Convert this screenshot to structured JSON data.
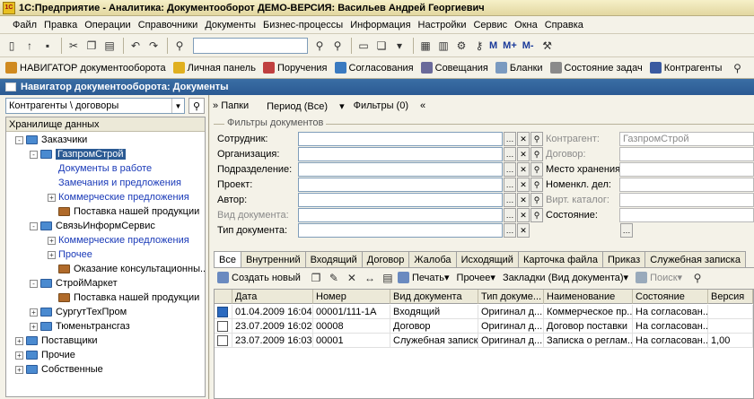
{
  "window": {
    "title": "1С:Предприятие - Аналитика: Документооборот ДЕМО-ВЕРСИЯ: Васильев Андрей Георгиевич",
    "app_icon": "1С"
  },
  "menu": [
    "Файл",
    "Правка",
    "Операции",
    "Справочники",
    "Документы",
    "Бизнес-процессы",
    "Информация",
    "Настройки",
    "Сервис",
    "Окна",
    "Справка"
  ],
  "toolbar": {
    "m1": "M",
    "m2": "M+",
    "m3": "M-"
  },
  "navbar": [
    {
      "label": "НАВИГАТОР документооборота",
      "icon": "navigator-icon",
      "color": "#d08a20"
    },
    {
      "label": "Личная панель",
      "icon": "panel-icon",
      "color": "#e0b020"
    },
    {
      "label": "Поручения",
      "icon": "tasks-icon",
      "color": "#c04040"
    },
    {
      "label": "Согласования",
      "icon": "approval-icon",
      "color": "#3a7ac0"
    },
    {
      "label": "Совещания",
      "icon": "meeting-icon",
      "color": "#6a6a9a"
    },
    {
      "label": "Бланки",
      "icon": "forms-icon",
      "color": "#7a9ac0"
    },
    {
      "label": "Состояние задач",
      "icon": "status-icon",
      "color": "#8a8a8a"
    },
    {
      "label": "Контрагенты",
      "icon": "contractors-icon",
      "color": "#3a5aa0"
    }
  ],
  "doc_title": "Навигатор документооборота: Документы",
  "left": {
    "selector": "Контрагенты \\ договоры",
    "tree_header": "Хранилище данных",
    "tree": [
      {
        "label": "Заказчики",
        "kind": "folder",
        "exp": "-"
      },
      {
        "label": "ГазпромСтрой",
        "kind": "folder",
        "exp": "-",
        "selected": true
      },
      {
        "label": "Документы в работе",
        "kind": "link"
      },
      {
        "label": "Замечания и предложения",
        "kind": "link"
      },
      {
        "label": "Коммерческие предложения",
        "kind": "link",
        "exp": "+"
      },
      {
        "label": "Поставка нашей продукции",
        "kind": "case"
      },
      {
        "label": "СвязьИнформСервис",
        "kind": "folder",
        "exp": "-"
      },
      {
        "label": "Коммерческие предложения",
        "kind": "link",
        "exp": "+"
      },
      {
        "label": "Прочее",
        "kind": "link",
        "exp": "+"
      },
      {
        "label": "Оказание консультационны...",
        "kind": "case"
      },
      {
        "label": "СтройМаркет",
        "kind": "folder",
        "exp": "-"
      },
      {
        "label": "Поставка нашей продукции",
        "kind": "case"
      },
      {
        "label": "СургутТехПром",
        "kind": "folder",
        "exp": "+"
      },
      {
        "label": "Тюменьтрансгаз",
        "kind": "folder",
        "exp": "+"
      },
      {
        "label": "Поставщики",
        "kind": "folder",
        "exp": "+"
      },
      {
        "label": "Прочие",
        "kind": "folder",
        "exp": "+"
      },
      {
        "label": "Собственные",
        "kind": "folder",
        "exp": "+"
      }
    ]
  },
  "right": {
    "bar": [
      "Папки",
      "Период (Все)",
      "Фильтры (0)"
    ],
    "filters_title": "Фильтры документов",
    "filters": [
      "Сотрудник:",
      "Организация:",
      "Подразделение:",
      "Проект:",
      "Автор:",
      "Вид документа:",
      "Тип документа:"
    ],
    "right_filters": [
      {
        "label": "Контрагент:",
        "value": "ГазпромСтрой",
        "gray": true
      },
      {
        "label": "Договор:",
        "gray": true
      },
      {
        "label": "Место хранения:"
      },
      {
        "label": "Номенкл. дел:"
      },
      {
        "label": "Вирт. каталог:",
        "gray": true
      },
      {
        "label": "Состояние:"
      }
    ],
    "tabs": [
      "Все",
      "Внутренний",
      "Входящий",
      "Договор",
      "Жалоба",
      "Исходящий",
      "Карточка файла",
      "Приказ",
      "Служебная записка"
    ],
    "grid_toolbar": {
      "create": "Создать новый",
      "print": "Печать",
      "other": "Прочее",
      "bookmarks": "Закладки (Вид документа)",
      "search": "Поиск"
    },
    "columns": [
      "Дата",
      "Номер",
      "Вид документа",
      "Тип докуме...",
      "Наименование",
      "Состояние",
      "Версия"
    ],
    "rows": [
      [
        "01.04.2009 16:04",
        "00001/111-1А",
        "Входящий",
        "Оригинал д...",
        "Коммерческое пр...",
        "На согласован...",
        ""
      ],
      [
        "23.07.2009 16:02",
        "00008",
        "Договор",
        "Оригинал д...",
        "Договор поставки",
        "На согласован...",
        ""
      ],
      [
        "23.07.2009 16:03",
        "00001",
        "Служебная записка",
        "Оригинал д...",
        "Записка о реглам...",
        "На согласован...",
        "1,00"
      ]
    ]
  }
}
